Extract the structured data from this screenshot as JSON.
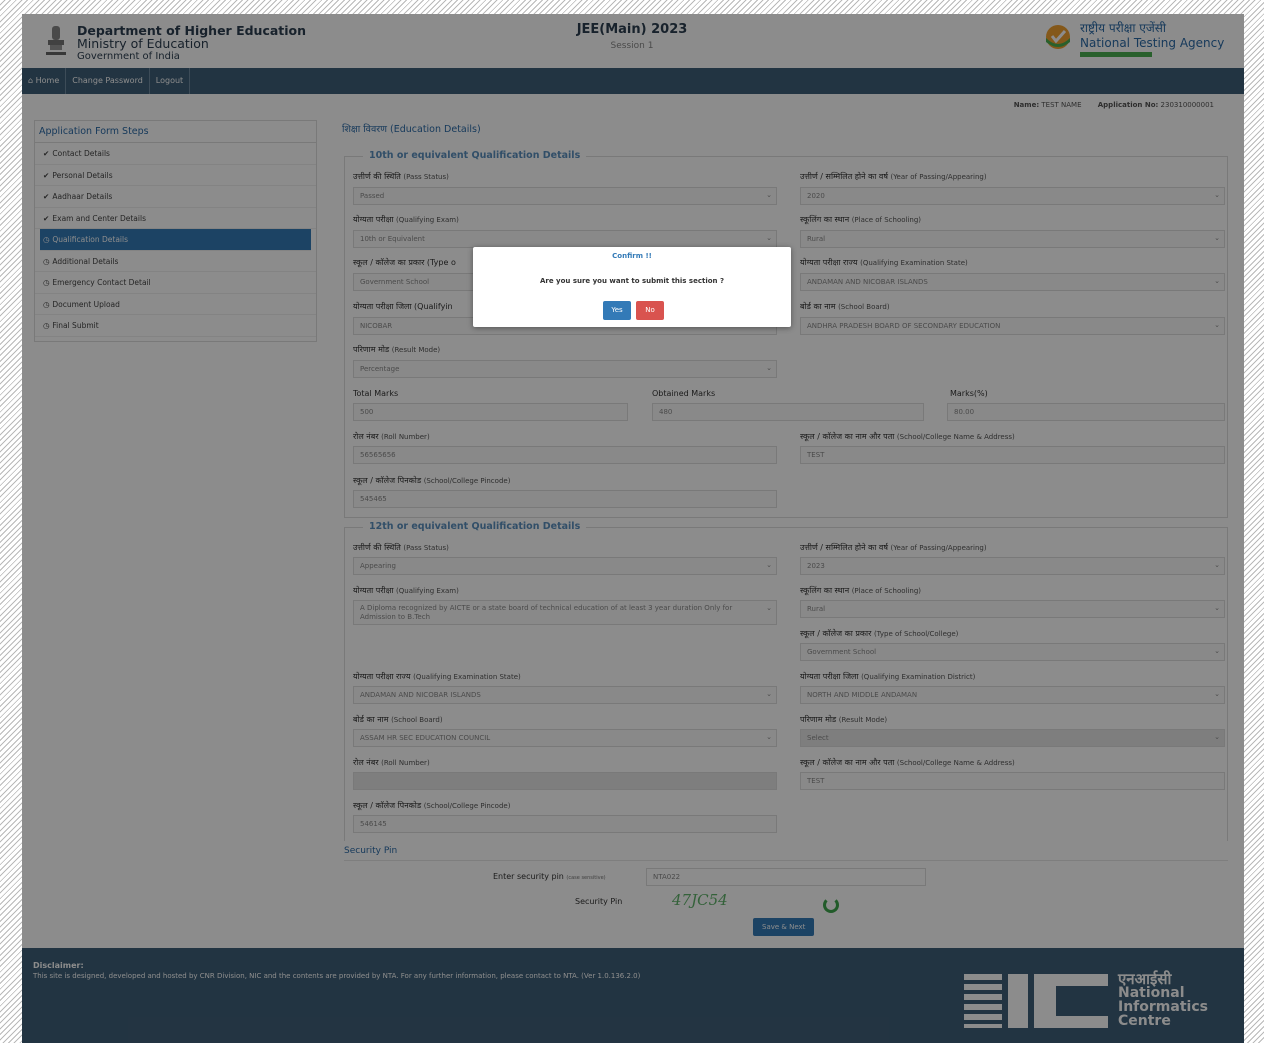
{
  "header": {
    "dept_line1": "Department of Higher Education",
    "dept_line2": "Ministry of Education",
    "dept_line3": "Government of India",
    "exam_title": "JEE(Main) 2023",
    "exam_session": "Session 1",
    "nta_hindi": "राष्ट्रीय परीक्षा एजेंसी",
    "nta_english": "National Testing Agency"
  },
  "nav": {
    "home": "⌂ Home",
    "change_password": "Change Password",
    "logout": "Logout"
  },
  "user": {
    "name_label": "Name:",
    "name_value": "TEST NAME",
    "appno_label": "Application No:",
    "appno_value": "230310000001"
  },
  "sidebar": {
    "title": "Application Form Steps",
    "steps": [
      {
        "label": "Contact Details",
        "icon": "✔"
      },
      {
        "label": "Personal Details",
        "icon": "✔"
      },
      {
        "label": "Aadhaar Details",
        "icon": "✔"
      },
      {
        "label": "Exam and Center Details",
        "icon": "✔"
      },
      {
        "label": "Qualification Details",
        "icon": "◷"
      },
      {
        "label": "Additional Details",
        "icon": "◷"
      },
      {
        "label": "Emergency Contact Detail",
        "icon": "◷"
      },
      {
        "label": "Document Upload",
        "icon": "◷"
      },
      {
        "label": "Final Submit",
        "icon": "◷"
      }
    ]
  },
  "main": {
    "title": "शिक्षा विवरण (Education Details)",
    "tenth": {
      "legend": "10th or equivalent Qualification Details",
      "pass_status_label": "उत्तीर्ण की स्थिति",
      "pass_status_en": "(Pass Status)",
      "pass_status_value": "Passed",
      "year_label": "उत्तीर्ण / सम्मिलित होने का वर्ष",
      "year_en": "(Year of Passing/Appearing)",
      "year_value": "2020",
      "exam_label": "योग्यता परीक्षा",
      "exam_en": "(Qualifying Exam)",
      "exam_value": "10th or Equivalent",
      "place_label": "स्कूलिंग का स्थान",
      "place_en": "(Place of Schooling)",
      "place_value": "Rural",
      "type_label": "स्कूल / कॉलेज का प्रकार (Type o",
      "type_value": "Government School",
      "state_label": "योग्यता परीक्षा राज्य",
      "state_en": "(Qualifying Examination State)",
      "state_value": "ANDAMAN AND NICOBAR ISLANDS",
      "district_label": "योग्यता परीक्षा जिला (Qualifyin",
      "district_value": "NICOBAR",
      "board_label": "बोर्ड का नाम",
      "board_en": "(School Board)",
      "board_value": "ANDHRA PRADESH BOARD OF SECONDARY EDUCATION",
      "result_label": "परिणाम मोड",
      "result_en": "(Result Mode)",
      "result_value": "Percentage",
      "total_label": "Total Marks",
      "total_value": "500",
      "obtained_label": "Obtained Marks",
      "obtained_value": "480",
      "percent_label": "Marks(%)",
      "percent_value": "80.00",
      "roll_label": "रोल नंबर",
      "roll_en": "(Roll Number)",
      "roll_value": "56565656",
      "school_label": "स्कूल / कॉलेज का नाम और पता",
      "school_en": "(School/College Name & Address)",
      "school_value": "TEST",
      "pincode_label": "स्कूल / कॉलेज पिनकोड",
      "pincode_en": "(School/College Pincode)",
      "pincode_value": "545465"
    },
    "twelfth": {
      "legend": "12th or equivalent Qualification Details",
      "pass_status_label": "उत्तीर्ण की स्थिति",
      "pass_status_en": "(Pass Status)",
      "pass_status_value": "Appearing",
      "year_label": "उत्तीर्ण / सम्मिलित होने का वर्ष",
      "year_en": "(Year of Passing/Appearing)",
      "year_value": "2023",
      "exam_label": "योग्यता परीक्षा",
      "exam_en": "(Qualifying Exam)",
      "exam_value": "A Diploma recognized by AICTE or a state board of technical education of at least 3 year duration Only for Admission to B.Tech",
      "place_label": "स्कूलिंग का स्थान",
      "place_en": "(Place of Schooling)",
      "place_value": "Rural",
      "type_label": "स्कूल / कॉलेज का प्रकार",
      "type_en": "(Type of School/College)",
      "type_value": "Government School",
      "state_label": "योग्यता परीक्षा राज्य",
      "state_en": "(Qualifying Examination State)",
      "state_value": "ANDAMAN AND NICOBAR ISLANDS",
      "district_label": "योग्यता परीक्षा जिला",
      "district_en": "(Qualifying Examination District)",
      "district_value": "NORTH AND MIDDLE ANDAMAN",
      "board_label": "बोर्ड का नाम",
      "board_en": "(School Board)",
      "board_value": "ASSAM HR SEC EDUCATION COUNCIL",
      "result_label": "परिणाम मोड",
      "result_en": "(Result Mode)",
      "result_value": "Select",
      "roll_label": "रोल नंबर",
      "roll_en": "(Roll Number)",
      "roll_value": "",
      "school_label": "स्कूल / कॉलेज का नाम और पता",
      "school_en": "(School/College Name & Address)",
      "school_value": "TEST",
      "pincode_label": "स्कूल / कॉलेज पिनकोड",
      "pincode_en": "(School/College Pincode)",
      "pincode_value": "546145"
    },
    "security": {
      "title": "Security Pin",
      "enter_label": "Enter security pin",
      "case_note": "(case sensitive)",
      "pin_value": "NTA022",
      "pin_label": "Security Pin",
      "captcha": "47JC54",
      "save_button": "Save & Next"
    }
  },
  "footer": {
    "disclaimer_title": "Disclaimer:",
    "disclaimer_text": "This site is designed, developed and hosted by CNR Division, NIC and the contents are provided by NTA. For any further information, please contact to NTA. (Ver 1.0.136.2.0)",
    "nic_hindi": "एनआईसी",
    "nic_line1": "National",
    "nic_line2": "Informatics",
    "nic_line3": "Centre"
  },
  "modal": {
    "title": "Confirm !!",
    "question": "Are you sure you want to submit this section ?",
    "yes": "Yes",
    "no": "No"
  },
  "colors": {
    "primary": "#337ab7",
    "navbar": "#3f5f78",
    "danger": "#d9534f",
    "nta_blue": "#2b6aa7"
  }
}
